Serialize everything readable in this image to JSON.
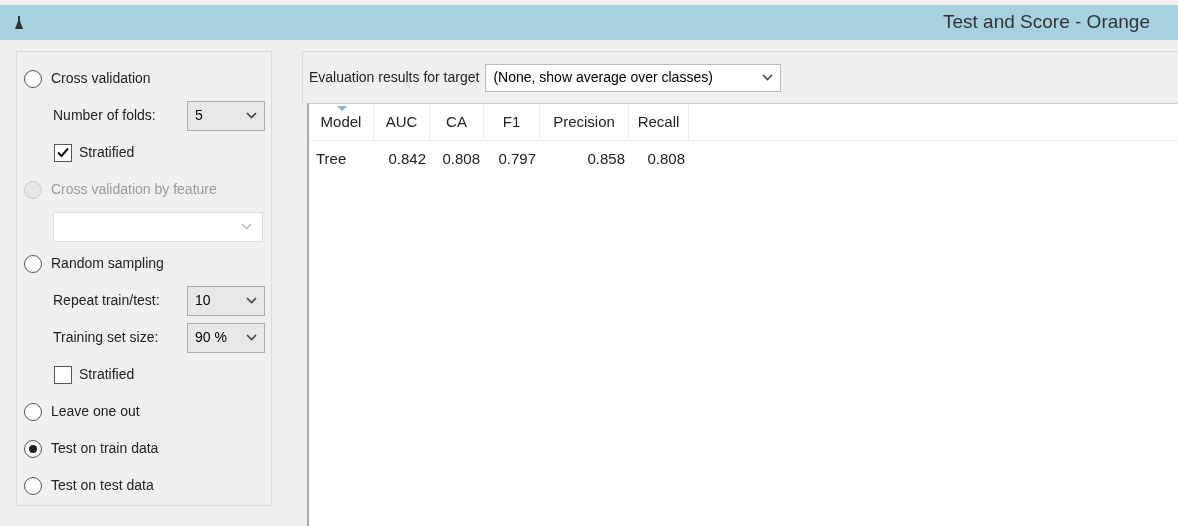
{
  "window": {
    "title": "Test and Score - Orange"
  },
  "sampling": [
    {
      "kind": "radio",
      "label": "Cross validation",
      "selected": false,
      "disabled": false
    },
    {
      "kind": "combo",
      "label": "Number of folds:",
      "value": "5"
    },
    {
      "kind": "checkbox",
      "label": "Stratified",
      "checked": true
    },
    {
      "kind": "radio",
      "label": "Cross validation by feature",
      "selected": false,
      "disabled": true
    },
    {
      "kind": "combo",
      "disabled": true
    },
    {
      "kind": "radio",
      "label": "Random sampling",
      "selected": false,
      "disabled": false
    },
    {
      "kind": "combo",
      "label": "Repeat train/test:",
      "value": "10"
    },
    {
      "kind": "combo",
      "label": "Training set size:",
      "value": "90 %"
    },
    {
      "kind": "checkbox",
      "label": "Stratified",
      "checked": false
    },
    {
      "kind": "radio",
      "label": "Leave one out",
      "selected": false,
      "disabled": false
    },
    {
      "kind": "radio",
      "label": "Test on train data",
      "selected": true,
      "disabled": false
    },
    {
      "kind": "radio",
      "label": "Test on test data",
      "selected": false,
      "disabled": false
    }
  ],
  "target": {
    "label": "Evaluation results for target",
    "value": "(None, show average over classes)"
  },
  "table": {
    "columns": [
      {
        "label": "Model",
        "sorted": true
      },
      {
        "label": "AUC",
        "sorted": false
      },
      {
        "label": "CA",
        "sorted": false
      },
      {
        "label": "F1",
        "sorted": false
      },
      {
        "label": "Precision",
        "sorted": false
      },
      {
        "label": "Recall",
        "sorted": false
      }
    ],
    "rows": [
      [
        "Tree",
        "0.842",
        "0.808",
        "0.797",
        "0.858",
        "0.808"
      ]
    ]
  }
}
